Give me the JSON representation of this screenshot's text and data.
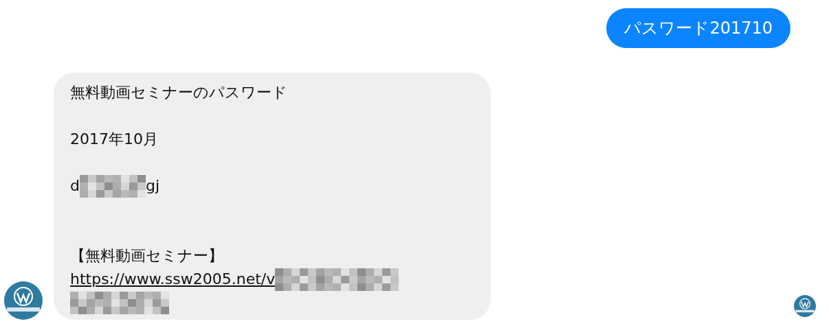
{
  "messages": [
    {
      "kind": "sent",
      "text": "パスワード201710"
    },
    {
      "kind": "received",
      "lines": [
        {
          "kind": "text",
          "text": "無料動画セミナーのパスワード"
        },
        {
          "kind": "blank"
        },
        {
          "kind": "text",
          "text": "2017年10月"
        },
        {
          "kind": "blank"
        },
        {
          "kind": "redacted",
          "before": "d",
          "after": "gj"
        },
        {
          "kind": "blank"
        },
        {
          "kind": "blank"
        },
        {
          "kind": "text",
          "text": "【無料動画セミナー】"
        },
        {
          "kind": "link",
          "text": "https://www.ssw2005.net/v"
        },
        {
          "kind": "mosaic"
        }
      ]
    }
  ]
}
